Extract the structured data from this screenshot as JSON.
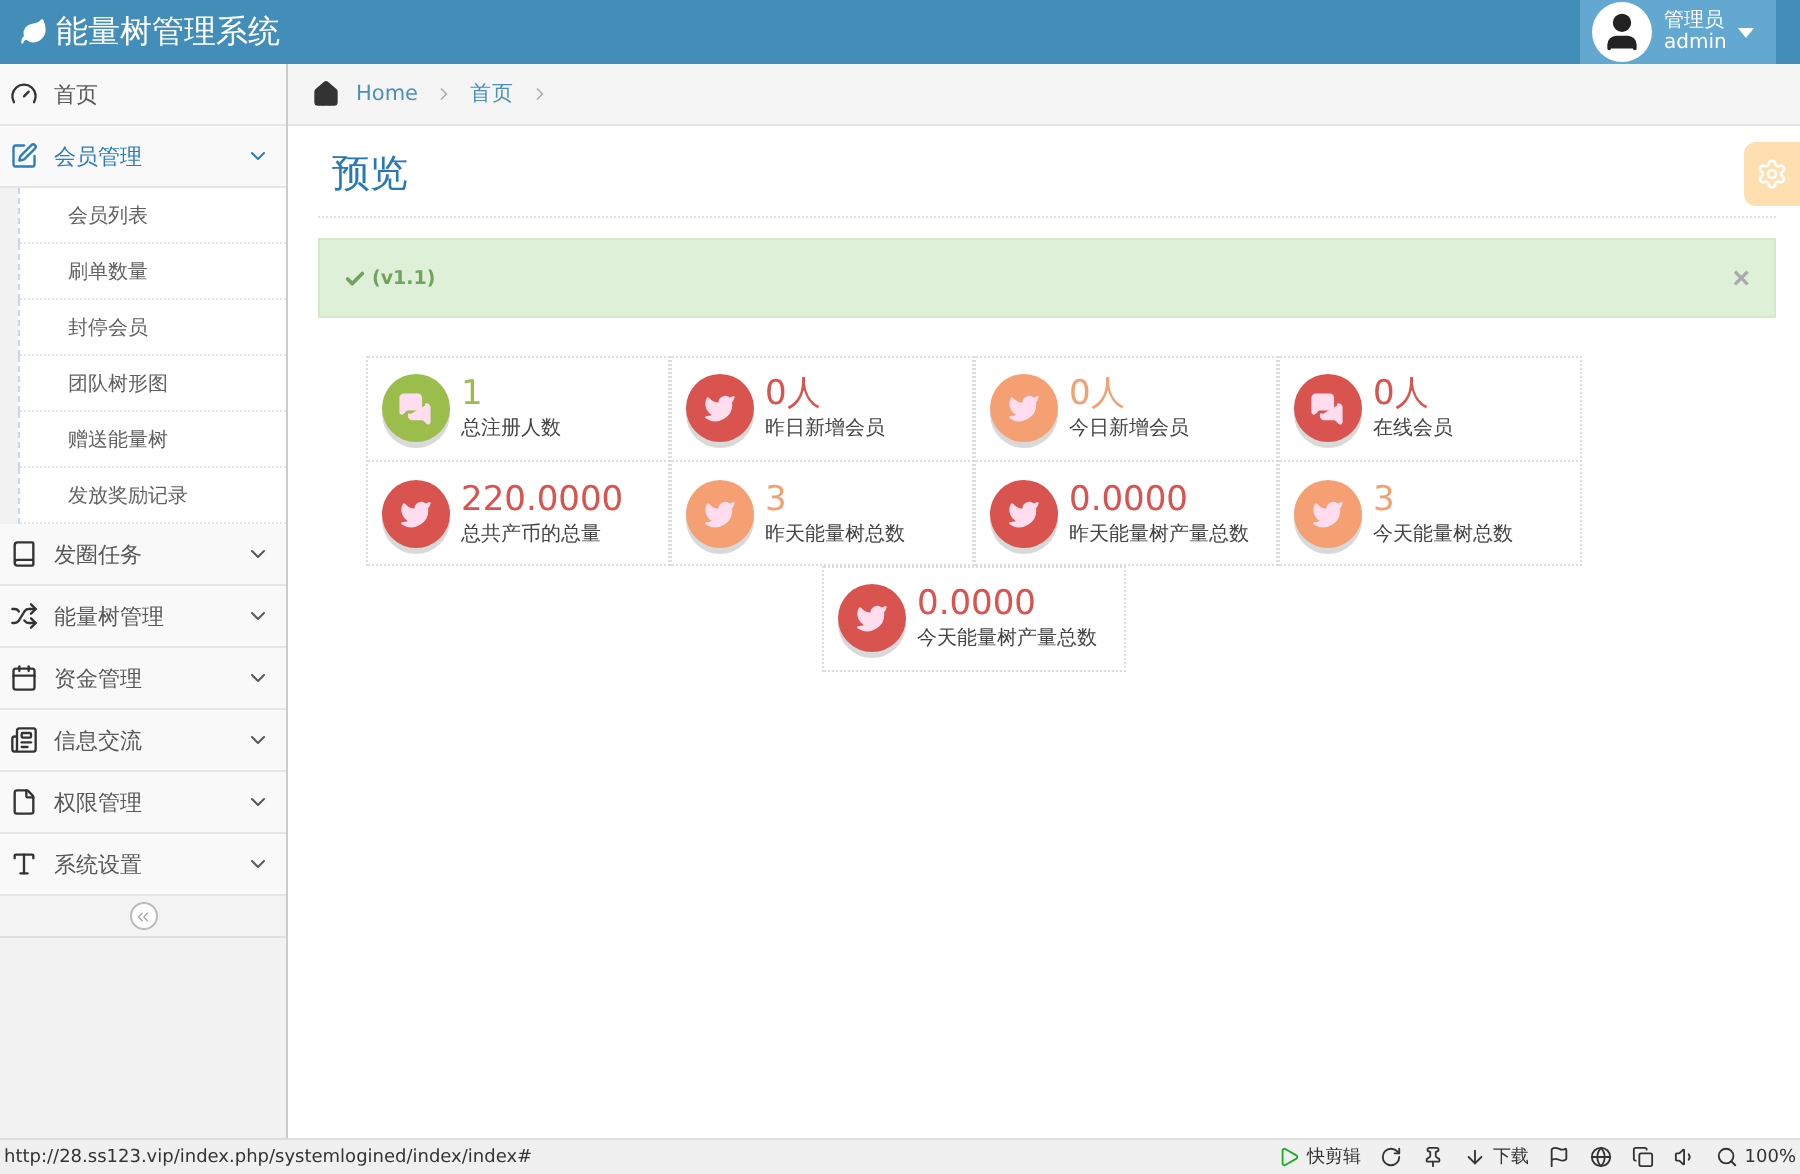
{
  "header": {
    "title": "能量树管理系统",
    "user": {
      "role": "管理员",
      "name": "admin"
    }
  },
  "sidebar": {
    "items": [
      {
        "label": "首页",
        "expanded": false
      },
      {
        "label": "会员管理",
        "expanded": true,
        "children": [
          {
            "label": "会员列表"
          },
          {
            "label": "刷单数量"
          },
          {
            "label": "封停会员"
          },
          {
            "label": "团队树形图"
          },
          {
            "label": "赠送能量树"
          },
          {
            "label": "发放奖励记录"
          }
        ]
      },
      {
        "label": "发圈任务",
        "expanded": false
      },
      {
        "label": "能量树管理",
        "expanded": false
      },
      {
        "label": "资金管理",
        "expanded": false
      },
      {
        "label": "信息交流",
        "expanded": false
      },
      {
        "label": "权限管理",
        "expanded": false
      },
      {
        "label": "系统设置",
        "expanded": false
      }
    ]
  },
  "breadcrumb": [
    "Home",
    "首页"
  ],
  "page_title": "预览",
  "alert": {
    "text": "(v1.1)",
    "close": "×"
  },
  "stats": [
    {
      "kind": "comments",
      "color": "#9abd4b",
      "value": "1",
      "label": "总注册人数"
    },
    {
      "kind": "twitter",
      "color": "#d9534f",
      "value": "0人",
      "label": "昨日新增会员"
    },
    {
      "kind": "twitter",
      "color": "#f5a073",
      "value": "0人",
      "label": "今日新增会员"
    },
    {
      "kind": "comments",
      "color": "#d9534f",
      "value": "0人",
      "label": "在线会员"
    },
    {
      "kind": "twitter",
      "color": "#d9534f",
      "value": "220.0000",
      "label": "总共产币的总量"
    },
    {
      "kind": "twitter",
      "color": "#f5a073",
      "value": "3",
      "label": "昨天能量树总数"
    },
    {
      "kind": "twitter",
      "color": "#d9534f",
      "value": "0.0000",
      "label": "昨天能量树产量总数"
    },
    {
      "kind": "twitter",
      "color": "#f5a073",
      "value": "3",
      "label": "今天能量树总数"
    },
    {
      "kind": "twitter",
      "color": "#d9534f",
      "value": "0.0000",
      "label": "今天能量树产量总数"
    }
  ],
  "status_bar": {
    "url": "http://28.ss123.vip/index.php/systemlogined/index/index#",
    "clip": "快剪辑",
    "download": "下载",
    "zoom": "100%"
  }
}
